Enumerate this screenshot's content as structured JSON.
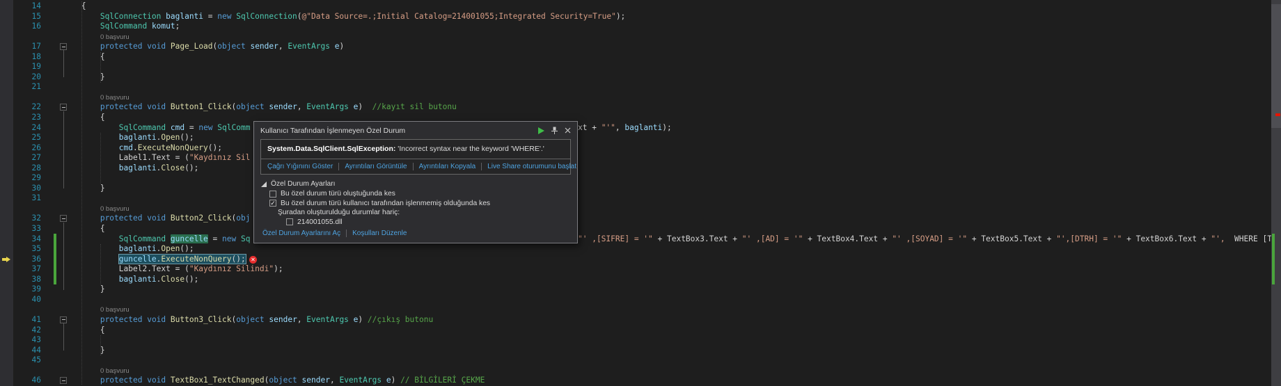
{
  "editor": {
    "palette": {
      "background": "#1e1e1e",
      "plain": "#d4d4d4",
      "keyword": "#569cd6",
      "type": "#4ec9b0",
      "string": "#d69d85",
      "comment": "#57a64a",
      "method": "#dcdcaa",
      "identifier": "#9cdcfe",
      "line_number": "#2b91af",
      "codelens": "#8a8a8a",
      "change_bar": "#4aa53c",
      "error": "#e62d2d",
      "current_statement_bg": "#1d4f5f",
      "reference_highlight_bg": "#2a6e4e"
    },
    "lines": [
      {
        "n": "14",
        "segs": [
          {
            "t": "        {"
          }
        ]
      },
      {
        "n": "15",
        "segs": [
          {
            "t": "            "
          },
          {
            "t": "SqlConnection",
            "c": "ty"
          },
          {
            "t": " "
          },
          {
            "t": "baglanti",
            "c": "id"
          },
          {
            "t": " = "
          },
          {
            "t": "new",
            "c": "kw"
          },
          {
            "t": " "
          },
          {
            "t": "SqlConnection",
            "c": "ty"
          },
          {
            "t": "("
          },
          {
            "t": "@\"Data Source=.;Initial Catalog=214001055;Integrated Security=True\"",
            "c": "str"
          },
          {
            "t": ");"
          }
        ]
      },
      {
        "n": "16",
        "segs": [
          {
            "t": "            "
          },
          {
            "t": "SqlCommand",
            "c": "ty"
          },
          {
            "t": " "
          },
          {
            "t": "komut",
            "c": "id"
          },
          {
            "t": ";"
          }
        ]
      },
      {
        "codelens": "0 başvuru"
      },
      {
        "n": "17",
        "fold": true,
        "segs": [
          {
            "t": "            "
          },
          {
            "t": "protected",
            "c": "kw"
          },
          {
            "t": " "
          },
          {
            "t": "void",
            "c": "kw"
          },
          {
            "t": " "
          },
          {
            "t": "Page_Load",
            "c": "mth"
          },
          {
            "t": "("
          },
          {
            "t": "object",
            "c": "kw"
          },
          {
            "t": " "
          },
          {
            "t": "sender",
            "c": "id"
          },
          {
            "t": ", "
          },
          {
            "t": "EventArgs",
            "c": "ty"
          },
          {
            "t": " "
          },
          {
            "t": "e",
            "c": "id"
          },
          {
            "t": ")"
          }
        ]
      },
      {
        "n": "18",
        "segs": [
          {
            "t": "            {"
          }
        ]
      },
      {
        "n": "19",
        "segs": []
      },
      {
        "n": "20",
        "segs": [
          {
            "t": "            }"
          }
        ]
      },
      {
        "n": "21",
        "segs": []
      },
      {
        "codelens": "0 başvuru"
      },
      {
        "n": "22",
        "fold": true,
        "segs": [
          {
            "t": "            "
          },
          {
            "t": "protected",
            "c": "kw"
          },
          {
            "t": " "
          },
          {
            "t": "void",
            "c": "kw"
          },
          {
            "t": " "
          },
          {
            "t": "Button1_Click",
            "c": "mth"
          },
          {
            "t": "("
          },
          {
            "t": "object",
            "c": "kw"
          },
          {
            "t": " "
          },
          {
            "t": "sender",
            "c": "id"
          },
          {
            "t": ", "
          },
          {
            "t": "EventArgs",
            "c": "ty"
          },
          {
            "t": " "
          },
          {
            "t": "e",
            "c": "id"
          },
          {
            "t": ")  "
          },
          {
            "t": "//kayıt sil butonu",
            "c": "com"
          }
        ]
      },
      {
        "n": "23",
        "segs": [
          {
            "t": "            {"
          }
        ]
      },
      {
        "n": "24",
        "segs": [
          {
            "t": "                "
          },
          {
            "t": "SqlCommand",
            "c": "ty"
          },
          {
            "t": " "
          },
          {
            "t": "cmd",
            "c": "id"
          },
          {
            "t": " = "
          },
          {
            "t": "new",
            "c": "kw"
          },
          {
            "t": " "
          },
          {
            "t": "SqlComm",
            "c": "ty"
          }
        ],
        "frag": [
          {
            "t": "xt + "
          },
          {
            "t": "\"'\"",
            "c": "str"
          },
          {
            "t": ", "
          },
          {
            "t": "baglanti",
            "c": "id"
          },
          {
            "t": ");"
          }
        ]
      },
      {
        "n": "25",
        "segs": [
          {
            "t": "                "
          },
          {
            "t": "baglanti",
            "c": "id"
          },
          {
            "t": "."
          },
          {
            "t": "Open",
            "c": "mth"
          },
          {
            "t": "();"
          }
        ]
      },
      {
        "n": "26",
        "segs": [
          {
            "t": "                "
          },
          {
            "t": "cmd",
            "c": "id"
          },
          {
            "t": "."
          },
          {
            "t": "ExecuteNonQuery",
            "c": "mth"
          },
          {
            "t": "();"
          }
        ]
      },
      {
        "n": "27",
        "segs": [
          {
            "t": "                "
          },
          {
            "t": "Label1"
          },
          {
            "t": ".Text = ("
          },
          {
            "t": "\"Kaydınız Sil",
            "c": "str"
          }
        ]
      },
      {
        "n": "28",
        "segs": [
          {
            "t": "                "
          },
          {
            "t": "baglanti",
            "c": "id"
          },
          {
            "t": "."
          },
          {
            "t": "Close",
            "c": "mth"
          },
          {
            "t": "();"
          }
        ]
      },
      {
        "n": "29",
        "segs": []
      },
      {
        "n": "30",
        "segs": [
          {
            "t": "            }"
          }
        ]
      },
      {
        "n": "31",
        "segs": []
      },
      {
        "codelens": "0 başvuru"
      },
      {
        "n": "32",
        "fold": true,
        "segs": [
          {
            "t": "            "
          },
          {
            "t": "protected",
            "c": "kw"
          },
          {
            "t": " "
          },
          {
            "t": "void",
            "c": "kw"
          },
          {
            "t": " "
          },
          {
            "t": "Button2_Click",
            "c": "mth"
          },
          {
            "t": "("
          },
          {
            "t": "obj",
            "c": "kw"
          }
        ]
      },
      {
        "n": "33",
        "segs": [
          {
            "t": "            {"
          }
        ]
      },
      {
        "n": "34",
        "segs": [
          {
            "t": "                "
          },
          {
            "t": "SqlCommand",
            "c": "ty"
          },
          {
            "t": " "
          },
          {
            "t": "guncelle",
            "c": "id",
            "hl": "ref"
          },
          {
            "t": " = "
          },
          {
            "t": "new",
            "c": "kw"
          },
          {
            "t": " "
          },
          {
            "t": "Sq",
            "c": "ty"
          }
        ],
        "frag": [
          {
            "t": "\"' ,[SIFRE] = '\"",
            "c": "str"
          },
          {
            "t": " + TextBox3.Text + "
          },
          {
            "t": "\"' ,[AD] = '\"",
            "c": "str"
          },
          {
            "t": " + TextBox4.Text + "
          },
          {
            "t": "\"' ,[SOYAD] = '\"",
            "c": "str"
          },
          {
            "t": " + TextBox5.Text + "
          },
          {
            "t": "\"',[DTRH] = '\"",
            "c": "str"
          },
          {
            "t": " + TextBox6.Text + "
          },
          {
            "t": "\"',",
            "c": "str"
          },
          {
            "t": "  WHERE [TC] = "
          }
        ]
      },
      {
        "n": "35",
        "segs": [
          {
            "t": "                "
          },
          {
            "t": "baglanti",
            "c": "id"
          },
          {
            "t": "."
          },
          {
            "t": "Open",
            "c": "mth"
          },
          {
            "t": "();"
          }
        ]
      },
      {
        "n": "36",
        "arrow": true,
        "marker": "error",
        "segs": [
          {
            "t": "                "
          },
          {
            "t": "guncelle",
            "c": "id",
            "hl": "cur"
          },
          {
            "t": ".",
            "hl": "cur"
          },
          {
            "t": "ExecuteNonQuery",
            "c": "mth",
            "hl": "cur"
          },
          {
            "t": "();",
            "hl": "cur"
          }
        ]
      },
      {
        "n": "37",
        "segs": [
          {
            "t": "                "
          },
          {
            "t": "Label2"
          },
          {
            "t": ".Text = ("
          },
          {
            "t": "\"Kaydınız Silindi\"",
            "c": "str"
          },
          {
            "t": ");"
          }
        ]
      },
      {
        "n": "38",
        "segs": [
          {
            "t": "                "
          },
          {
            "t": "baglanti",
            "c": "id"
          },
          {
            "t": "."
          },
          {
            "t": "Close",
            "c": "mth"
          },
          {
            "t": "();"
          }
        ]
      },
      {
        "n": "39",
        "segs": [
          {
            "t": "            }"
          }
        ]
      },
      {
        "n": "40",
        "segs": []
      },
      {
        "codelens": "0 başvuru"
      },
      {
        "n": "41",
        "fold": true,
        "segs": [
          {
            "t": "            "
          },
          {
            "t": "protected",
            "c": "kw"
          },
          {
            "t": " "
          },
          {
            "t": "void",
            "c": "kw"
          },
          {
            "t": " "
          },
          {
            "t": "Button3_Click",
            "c": "mth"
          },
          {
            "t": "("
          },
          {
            "t": "object",
            "c": "kw"
          },
          {
            "t": " "
          },
          {
            "t": "sender",
            "c": "id"
          },
          {
            "t": ", "
          },
          {
            "t": "EventArgs",
            "c": "ty"
          },
          {
            "t": " "
          },
          {
            "t": "e",
            "c": "id"
          },
          {
            "t": ") "
          },
          {
            "t": "//çıkış butonu",
            "c": "com"
          }
        ]
      },
      {
        "n": "42",
        "segs": [
          {
            "t": "            {"
          }
        ]
      },
      {
        "n": "43",
        "segs": []
      },
      {
        "n": "44",
        "segs": [
          {
            "t": "            }"
          }
        ]
      },
      {
        "n": "45",
        "segs": []
      },
      {
        "codelens": "0 başvuru"
      },
      {
        "n": "46",
        "fold": true,
        "segs": [
          {
            "t": "            "
          },
          {
            "t": "protected",
            "c": "kw"
          },
          {
            "t": " "
          },
          {
            "t": "void",
            "c": "kw"
          },
          {
            "t": " "
          },
          {
            "t": "TextBox1_TextChanged",
            "c": "mth"
          },
          {
            "t": "("
          },
          {
            "t": "object",
            "c": "kw"
          },
          {
            "t": " "
          },
          {
            "t": "sender",
            "c": "id"
          },
          {
            "t": ", "
          },
          {
            "t": "EventArgs",
            "c": "ty"
          },
          {
            "t": " "
          },
          {
            "t": "e",
            "c": "id"
          },
          {
            "t": ") "
          },
          {
            "t": "// BİLGİLERİ ÇEKME",
            "c": "com"
          }
        ]
      }
    ]
  },
  "popup": {
    "title": "Kullanıcı Tarafından İşlenmeyen Özel Durum",
    "exception_type": "System.Data.SqlClient.SqlException:",
    "exception_message": " 'Incorrect syntax near the keyword 'WHERE'.'",
    "action_links": [
      "Çağrı Yığınını Göster",
      "Ayrıntıları Görüntüle",
      "Ayrıntıları Kopyala",
      "Live Share oturumunu başlat"
    ],
    "settings_title": "Özel Durum Ayarları",
    "break_when_thrown": {
      "label": "Bu özel durum türü oluştuğunda kes",
      "checked": false
    },
    "break_when_unhandled": {
      "label": "Bu özel durum türü kullanıcı tarafından işlenmemiş olduğunda kes",
      "checked": true
    },
    "except_from_note": "Şuradan oluşturulduğu durumlar hariç:",
    "except_module": {
      "label": "214001055.dll",
      "checked": false
    },
    "footer_links": [
      "Özel Durum Ayarlarını Aç",
      "Koşulları Düzenle"
    ],
    "icons": {
      "continue": "play-icon",
      "pin": "pin-icon",
      "close": "close-icon",
      "statement_error": "error-icon"
    }
  }
}
